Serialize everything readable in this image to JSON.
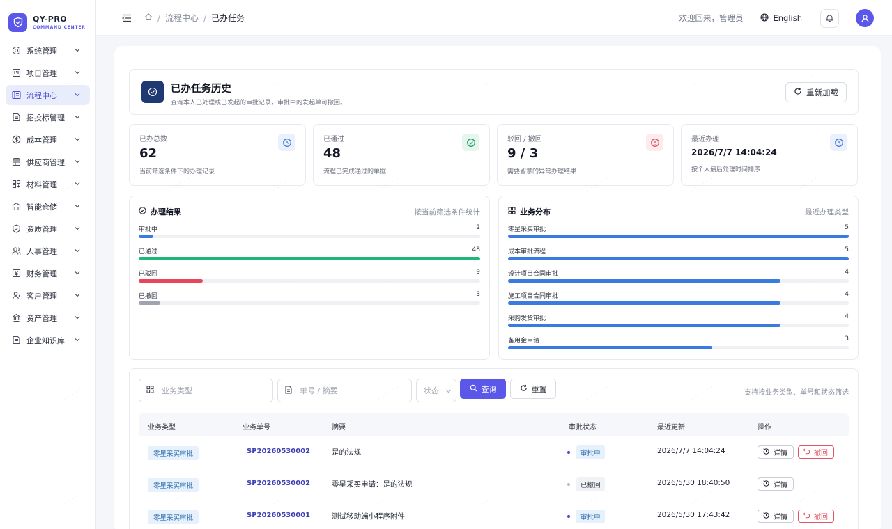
{
  "app": {
    "title": "QY-PRO",
    "subtitle": "COMMAND CENTER",
    "accent": "#5b57e8"
  },
  "sidebar": {
    "items": [
      {
        "label": "系统管理",
        "icon": "gear-icon"
      },
      {
        "label": "项目管理",
        "icon": "project-icon"
      },
      {
        "label": "流程中心",
        "icon": "flow-icon",
        "active": true
      },
      {
        "label": "招投标管理",
        "icon": "bid-icon"
      },
      {
        "label": "成本管理",
        "icon": "cost-icon"
      },
      {
        "label": "供应商管理",
        "icon": "supplier-icon"
      },
      {
        "label": "材料管理",
        "icon": "material-icon"
      },
      {
        "label": "智能仓储",
        "icon": "warehouse-icon"
      },
      {
        "label": "资质管理",
        "icon": "qualification-icon"
      },
      {
        "label": "人事管理",
        "icon": "hr-icon"
      },
      {
        "label": "财务管理",
        "icon": "finance-icon"
      },
      {
        "label": "客户管理",
        "icon": "customer-icon"
      },
      {
        "label": "资产管理",
        "icon": "asset-icon"
      },
      {
        "label": "企业知识库",
        "icon": "knowledge-icon"
      }
    ]
  },
  "topbar": {
    "breadcrumb": [
      "流程中心",
      "已办任务"
    ],
    "welcome": "欢迎回来，管理员",
    "language": "English"
  },
  "header": {
    "title": "已办任务历史",
    "description": "查询本人已处理或已发起的审批记录，审批中的发起单可撤回。",
    "reload_label": "重新加载"
  },
  "stats": [
    {
      "label": "已办总数",
      "value": "62",
      "hint": "当前筛选条件下的办理记录",
      "icon": "clock-icon",
      "color": "#4a7bd8"
    },
    {
      "label": "已通过",
      "value": "48",
      "hint": "流程已完成通过的单据",
      "icon": "check-circle-icon",
      "color": "#1fa466"
    },
    {
      "label": "驳回 / 撤回",
      "value": "9 / 3",
      "hint": "需要留意的异常办理结果",
      "icon": "alert-circle-icon",
      "color": "#e05565"
    },
    {
      "label": "最近办理",
      "value": "2026/7/7 14:04:24",
      "hint": "按个人最后处理时间排序",
      "icon": "clock-icon",
      "color": "#4a7bd8"
    }
  ],
  "results": {
    "title": "办理结果",
    "note": "按当前筛选条件统计",
    "max": 48,
    "rows": [
      {
        "label": "审批中",
        "value": 2,
        "color": "#3b7be0"
      },
      {
        "label": "已通过",
        "value": 48,
        "color": "#1fb87a"
      },
      {
        "label": "已驳回",
        "value": 9,
        "color": "#e8445a"
      },
      {
        "label": "已撤回",
        "value": 3,
        "color": "#a0a4b0"
      }
    ]
  },
  "business": {
    "title": "业务分布",
    "note": "最近办理类型",
    "max": 5,
    "rows": [
      {
        "label": "零星采买审批",
        "value": 5,
        "color": "#3b7be0"
      },
      {
        "label": "成本审批流程",
        "value": 5,
        "color": "#3b7be0"
      },
      {
        "label": "设计项目合同审批",
        "value": 4,
        "color": "#3b7be0"
      },
      {
        "label": "施工项目合同审批",
        "value": 4,
        "color": "#3b7be0"
      },
      {
        "label": "采购发货审批",
        "value": 4,
        "color": "#3b7be0"
      },
      {
        "label": "备用金申请",
        "value": 3,
        "color": "#3b7be0"
      }
    ]
  },
  "filters": {
    "type_placeholder": "业务类型",
    "no_placeholder": "单号 / 摘要",
    "status_placeholder": "状态",
    "query_label": "查询",
    "reset_label": "重置",
    "hint": "支持按业务类型、单号和状态筛选"
  },
  "table": {
    "columns": [
      "业务类型",
      "业务单号",
      "摘要",
      "审批状态",
      "最近更新",
      "操作"
    ],
    "detail_label": "详情",
    "revoke_label": "撤回",
    "rows": [
      {
        "type": "零星采买审批",
        "no": "SP20260530002",
        "summary": "是的法规",
        "status": "审批中",
        "status_kind": "pending",
        "updated": "2026/7/7 14:04:24",
        "can_revoke": true
      },
      {
        "type": "零星采买审批",
        "no": "SP20260530002",
        "summary": "零星采买申请：是的法规",
        "status": "已撤回",
        "status_kind": "revoked",
        "updated": "2026/5/30 18:40:50",
        "can_revoke": false
      },
      {
        "type": "零星采买审批",
        "no": "SP20260530001",
        "summary": "测试移动端小程序附件",
        "status": "审批中",
        "status_kind": "pending",
        "updated": "2026/5/30 17:43:42",
        "can_revoke": true
      }
    ]
  }
}
